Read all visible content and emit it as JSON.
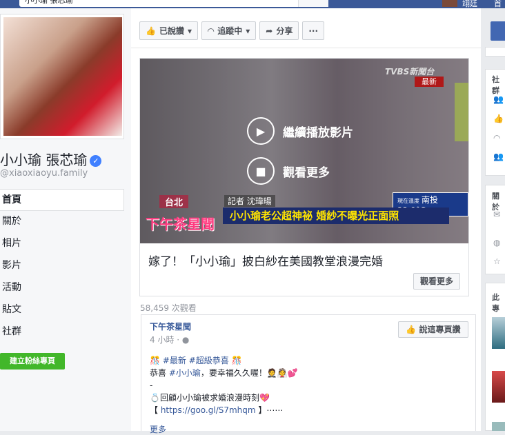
{
  "topbar": {
    "search_value": "小小瑜 張芯瑜",
    "user_name": "翊廷",
    "home_label": "首"
  },
  "profile": {
    "name": "小小瑜 張芯瑜",
    "handle": "@xiaoxiaoyu.family"
  },
  "nav": {
    "items": [
      "首頁",
      "關於",
      "相片",
      "影片",
      "活動",
      "貼文",
      "社群"
    ],
    "create_button": "建立粉絲專頁"
  },
  "action_bar": {
    "liked_label": "已說讚",
    "following_label": "追蹤中",
    "share_label": "分享",
    "more_label": "···"
  },
  "video": {
    "continue_label": "繼續播放影片",
    "watch_more_label": "觀看更多",
    "overlay": {
      "channel": "TVBS新聞台",
      "news_tag": "最新",
      "location": "台北",
      "reporter": "記者 沈瑋暘",
      "weather": "南投 22.9°C",
      "weather_label": "現在溫度",
      "caption": "小小瑜老公超神祕 婚紗不曝光正面照",
      "show_logo": "下午茶星聞"
    },
    "title": "嫁了！「小小瑜」披白紗在美國教堂浪漫完婚",
    "more_button": "觀看更多",
    "views": "58,459 次觀看"
  },
  "post": {
    "page_name": "下午茶星聞",
    "time": "4 小時 · ",
    "say_button": "說這專頁讚",
    "line1_tag1": "#最新",
    "line1_tag2": "#超級恭喜",
    "line2_pre": "恭喜 ",
    "line2_tag": "#小小瑜",
    "line2_post": "，要幸福久久喔！",
    "line3": "-",
    "line4": "回顧小小瑜被求婚浪漫時刻",
    "line5_pre": "【 ",
    "line5_link": "https://goo.gl/S7mhqm",
    "line5_post": " 】⋯⋯",
    "more": "更多"
  },
  "right_rail": {
    "community_label": "社群",
    "about_label": "關於",
    "more_label": "此專"
  }
}
